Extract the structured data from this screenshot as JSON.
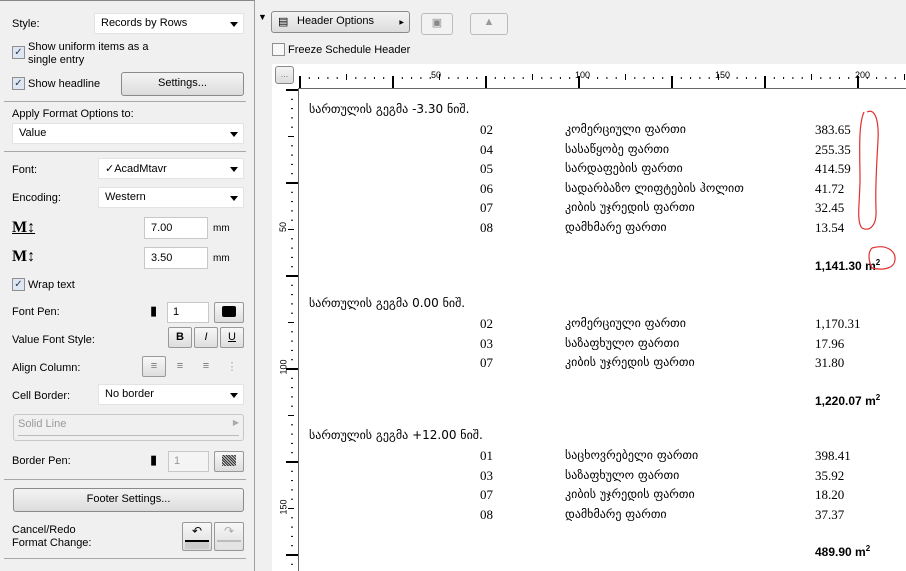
{
  "left_panel": {
    "style_label": "Style:",
    "style_value": "Records by Rows",
    "uniform_label": "Show uniform items as a single entry",
    "uniform_checked": true,
    "headline_label": "Show headline",
    "headline_checked": true,
    "settings_button": "Settings...",
    "apply_label": "Apply Format Options to:",
    "apply_value": "Value",
    "font_label": "Font:",
    "font_value": "✓AcadMtavr",
    "encoding_label": "Encoding:",
    "encoding_value": "Western",
    "size1_value": "7.00",
    "size2_value": "3.50",
    "unit": "mm",
    "wrap_label": "Wrap text",
    "wrap_checked": true,
    "font_pen_label": "Font Pen:",
    "font_pen_value": "1",
    "value_font_style_label": "Value Font Style:",
    "bold": "B",
    "italic": "I",
    "underline": "U",
    "align_label": "Align Column:",
    "cell_border_label": "Cell Border:",
    "cell_border_value": "No border",
    "line_type_value": "Solid Line",
    "border_pen_label": "Border Pen:",
    "border_pen_value": "1",
    "footer_button": "Footer Settings...",
    "cancel_redo_label_1": "Cancel/Redo",
    "cancel_redo_label_2": "Format Change:"
  },
  "toolbar": {
    "header_options": "Header Options",
    "freeze_label": "Freeze Schedule Header",
    "freeze_checked": false,
    "more_button": "..."
  },
  "ruler": {
    "labels": [
      "50",
      "100",
      "150",
      "200"
    ]
  },
  "vruler": {
    "labels": [
      "50",
      "100",
      "150"
    ]
  },
  "schedule": {
    "groups": [
      {
        "header": "სართულის გეგმა -3.30 ნიშ.",
        "total": "1,141.30",
        "rows": [
          {
            "code": "02",
            "name": "კომერციული ფართი",
            "value": "383.65"
          },
          {
            "code": "04",
            "name": "სასაწყობე ფართი",
            "value": "255.35"
          },
          {
            "code": "05",
            "name": "სარდაფების ფართი",
            "value": "414.59"
          },
          {
            "code": "06",
            "name": "სადარბაზო ლიფტების ჰოლით",
            "value": "41.72"
          },
          {
            "code": "07",
            "name": "კიბის უჯრედის ფართი",
            "value": "32.45"
          },
          {
            "code": "08",
            "name": "დამხმარე ფართი",
            "value": "13.54"
          }
        ]
      },
      {
        "header": "სართულის გეგმა 0.00 ნიშ.",
        "total": "1,220.07",
        "rows": [
          {
            "code": "02",
            "name": "კომერციული ფართი",
            "value": "1,170.31"
          },
          {
            "code": "03",
            "name": "საზაფხულო ფართი",
            "value": "17.96"
          },
          {
            "code": "07",
            "name": "კიბის უჯრედის ფართი",
            "value": "31.80"
          }
        ]
      },
      {
        "header": "სართულის გეგმა +12.00 ნიშ.",
        "total": "489.90",
        "rows": [
          {
            "code": "01",
            "name": "საცხოვრებელი ფართი",
            "value": "398.41"
          },
          {
            "code": "03",
            "name": "საზაფხულო ფართი",
            "value": "35.92"
          },
          {
            "code": "07",
            "name": "კიბის უჯრედის ფართი",
            "value": "18.20"
          },
          {
            "code": "08",
            "name": "დამხმარე ფართი",
            "value": "37.37"
          }
        ]
      }
    ],
    "unit": "m",
    "annotation_color": "#e03030"
  }
}
